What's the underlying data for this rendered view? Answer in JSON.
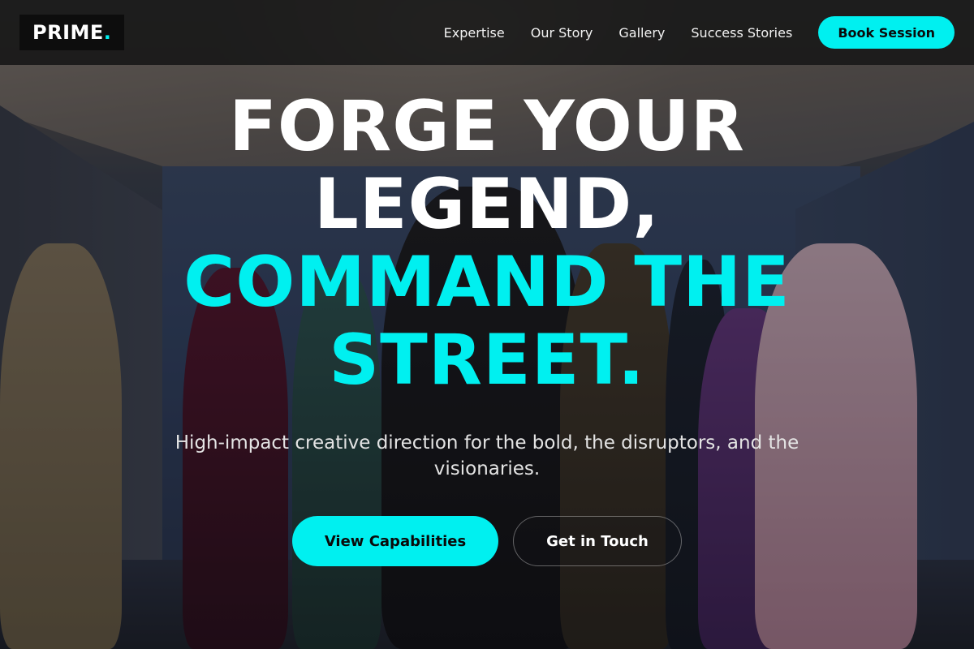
{
  "brand": {
    "name": "PRIME",
    "dot": ".",
    "accent_color": "#00f0f0"
  },
  "nav": {
    "links": [
      {
        "label": "Expertise"
      },
      {
        "label": "Our Story"
      },
      {
        "label": "Gallery"
      },
      {
        "label": "Success Stories"
      }
    ],
    "cta_label": "Book Session"
  },
  "hero": {
    "headline_lines": [
      {
        "text": "FORGE YOUR",
        "color": "#ffffff"
      },
      {
        "text": "LEGEND,",
        "color": "#ffffff"
      },
      {
        "text": "COMMAND THE",
        "color": "#00f0f0"
      },
      {
        "text": "STREET.",
        "color": "#00f0f0"
      }
    ],
    "subtitle": "High-impact creative direction for the bold, the disruptors, and the visionaries.",
    "primary_cta": "View Capabilities",
    "secondary_cta": "Get in Touch"
  }
}
